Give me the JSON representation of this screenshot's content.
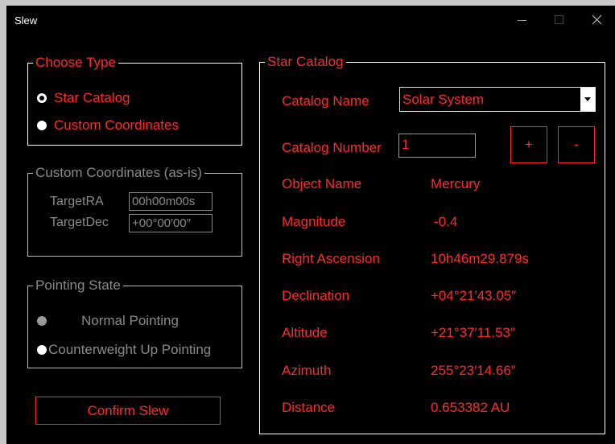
{
  "window": {
    "title": "Slew"
  },
  "choose_type": {
    "legend": "Choose Type",
    "options": [
      {
        "label": "Star Catalog",
        "checked": true
      },
      {
        "label": "Custom Coordinates",
        "checked": false
      }
    ]
  },
  "custom_coords": {
    "legend": "Custom Coordinates (as-is)",
    "ra_label": "TargetRA",
    "ra_value": "00h00m00s",
    "dec_label": "TargetDec",
    "dec_value": "+00°00′00″"
  },
  "pointing": {
    "legend": "Pointing State",
    "options": [
      {
        "label": "Normal Pointing",
        "checked": false
      },
      {
        "label": "Counterweight Up Pointing",
        "checked": false
      }
    ]
  },
  "confirm_label": "Confirm Slew",
  "star_catalog": {
    "legend": "Star Catalog",
    "catalog_name_label": "Catalog Name",
    "catalog_name_value": "Solar System",
    "catalog_number_label": "Catalog Number",
    "catalog_number_value": "1",
    "plus_label": "+",
    "minus_label": "-",
    "rows": [
      {
        "label": "Object Name",
        "value": "Mercury"
      },
      {
        "label": "Magnitude",
        "value": "-0.4"
      },
      {
        "label": "Right Ascension",
        "value": "10h46m29.879s"
      },
      {
        "label": "Declination",
        "value": "+04°21′43.05″"
      },
      {
        "label": "Altitude",
        "value": "+21°37′11.53″"
      },
      {
        "label": "Azimuth",
        "value": "255°23′14.66″"
      },
      {
        "label": "Distance",
        "value": "0.653382 AU"
      }
    ]
  },
  "colors": {
    "accent": "#ff2b2b",
    "background": "#000000",
    "dim_text": "#8a8a8a"
  }
}
